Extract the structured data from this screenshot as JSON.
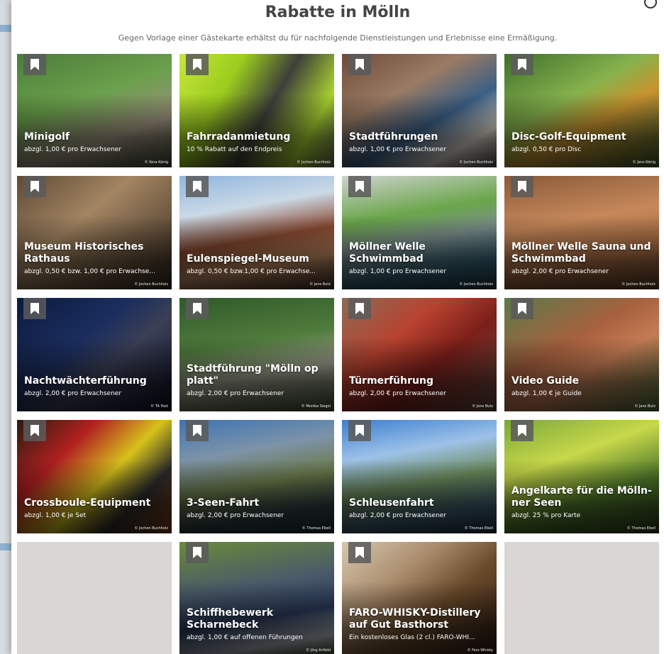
{
  "modal": {
    "title": "Rabatte in Mölln",
    "subtitle": "Gegen Vorlage einer Gästekarte erhältst du für nachfolgende Dienstleistungen und Erlebnisse eine Ermäßigung."
  },
  "icons": {
    "bookmark": "bookmark-icon",
    "close": "close-icon"
  },
  "cards": [
    {
      "title": "Minigolf",
      "sub": "abzgl. 1,00 € pro Erwachsener",
      "credit": "© Kora König",
      "bg": "minigolf"
    },
    {
      "title": "Fahrradanmietung",
      "sub": "10 % Rabatt auf den Endpreis",
      "credit": "© Jochen Buchholz",
      "bg": "fahrrad"
    },
    {
      "title": "Stadtführungen",
      "sub": "abzgl. 1,00 € pro Erwachsener",
      "credit": "© Jochen Buchholz",
      "bg": "stadt"
    },
    {
      "title": "Disc-Golf-Equipment",
      "sub": "abzgl. 0,50 € pro Disc",
      "credit": "© Jens König",
      "bg": "disc"
    },
    {
      "title": "Museum Historisches Rathaus",
      "sub": "abzgl. 0,50 € bzw. 1,00 € pro Erwachse...",
      "credit": "© Jochen Buchholz",
      "bg": "museum"
    },
    {
      "title": "Eulenspiegel-Museum",
      "sub": "abzgl. 0,50 € bzw.1,00 € pro Erwachse...",
      "credit": "© Jens Butz",
      "bg": "eulen"
    },
    {
      "title": "Möllner Welle Schwimmbad",
      "sub": "abzgl. 1,00 € pro Erwachsener",
      "credit": "© Jochen Buchholz",
      "bg": "welle"
    },
    {
      "title": "Möllner Welle Sauna und Schwimmbad",
      "sub": "abzgl. 2,00 € pro Erwachsener",
      "credit": "© Jochen Buchholz",
      "bg": "sauna"
    },
    {
      "title": "Nachtwächterführung",
      "sub": "abzgl. 2,00 € pro Erwachsener",
      "credit": "© TA Post",
      "bg": "nacht"
    },
    {
      "title": "Stadtführung \"Mölln op platt\"",
      "sub": "abzgl. 2,00 € pro Erwachsener",
      "credit": "© Monika Siegel",
      "bg": "platt"
    },
    {
      "title": "Türmerführung",
      "sub": "abzgl. 2,00 € pro Erwachsener",
      "credit": "© Jens Butz",
      "bg": "turm"
    },
    {
      "title": "Video Guide",
      "sub": "abzgl. 1,00 € je Guide",
      "credit": "© Jens Butz",
      "bg": "video"
    },
    {
      "title": "Crossboule-Equipment",
      "sub": "abzgl. 1,00 € je Set",
      "credit": "© Jochen Buchholz",
      "bg": "cross"
    },
    {
      "title": "3-Seen-Fahrt",
      "sub": "abzgl. 2,00 € pro Erwachsener",
      "credit": "© Thomas Ebell",
      "bg": "seen"
    },
    {
      "title": "Schleusenfahrt",
      "sub": "abzgl. 2,00 € pro Erwachsener",
      "credit": "© Thomas Ebell",
      "bg": "schleuse"
    },
    {
      "title": "Angelkarte für die Mölln-ner Seen",
      "sub": "abzgl. 25 % pro Karte",
      "credit": "© Thomas Ebell",
      "bg": "angel"
    },
    {
      "title": "Schiffhebewerk Scharnebeck",
      "sub": "abzgl. 1,00 € auf offenen Führungen",
      "credit": "© Jörg Artfeld",
      "bg": "schiff"
    },
    {
      "title": "FARO-WHISKY-Distillery auf Gut Basthorst",
      "sub": "Ein kostenloses Glas (2 cl.) FARO-WHI...",
      "credit": "© Faro Whisky",
      "bg": "faro"
    }
  ]
}
